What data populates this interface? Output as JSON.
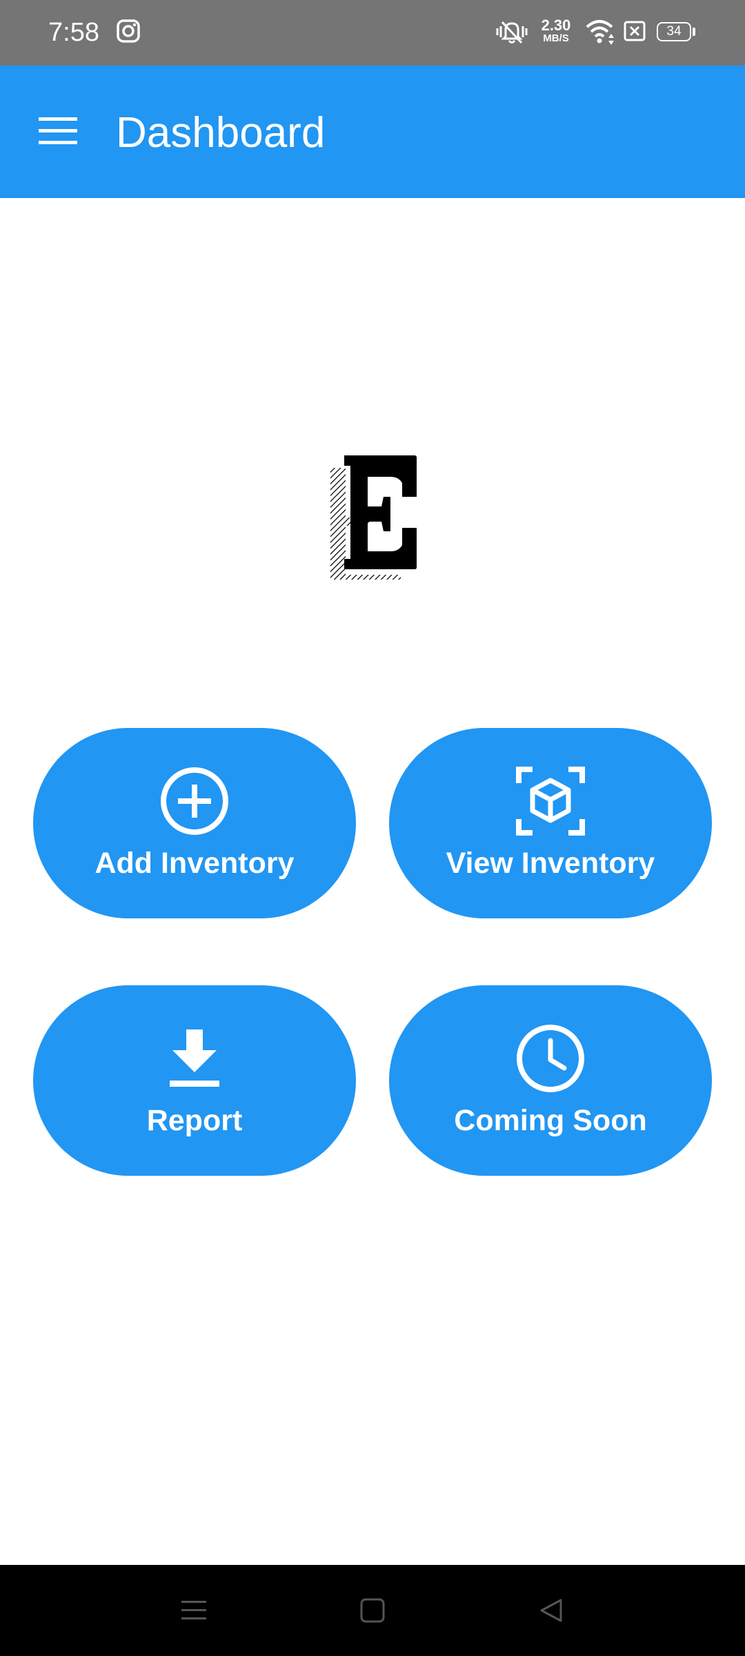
{
  "status_bar": {
    "time": "7:58",
    "net_speed_value": "2.30",
    "net_speed_unit": "MB/S",
    "battery": "34",
    "icons": [
      "instagram-icon",
      "vibrate-icon",
      "wifi-icon",
      "no-sim-icon",
      "battery-icon"
    ]
  },
  "app_bar": {
    "title": "Dashboard",
    "menu_icon": "hamburger-menu-icon"
  },
  "logo": {
    "letter": "E"
  },
  "actions": [
    {
      "label": "Add Inventory",
      "icon": "add-circle-icon"
    },
    {
      "label": "View Inventory",
      "icon": "view-in-ar-icon"
    },
    {
      "label": "Report",
      "icon": "download-icon"
    },
    {
      "label": "Coming Soon",
      "icon": "clock-icon"
    }
  ],
  "nav": {
    "icons": [
      "recents-icon",
      "home-icon",
      "back-icon"
    ]
  },
  "colors": {
    "primary": "#2196f3",
    "status_bar": "#757575",
    "nav_bar": "#000000"
  }
}
